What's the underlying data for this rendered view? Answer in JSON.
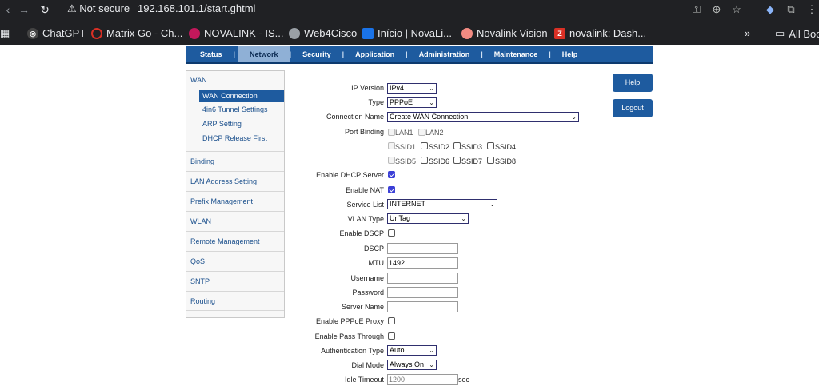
{
  "browser": {
    "secure_label": "Not secure",
    "url": "192.168.101.1/start.ghtml",
    "bookmarks": [
      {
        "label": "ChatGPT",
        "color": "#e8eaed"
      },
      {
        "label": "Matrix Go - Ch...",
        "color": "#d93025"
      },
      {
        "label": "NOVALINK - IS...",
        "color": "#c2185b"
      },
      {
        "label": "Web4Cisco",
        "color": "#9aa0a6"
      },
      {
        "label": "Início | NovaLi...",
        "color": "#1a73e8"
      },
      {
        "label": "Novalink Vision",
        "color": "#f28b82"
      },
      {
        "label": "novalink: Dash...",
        "color": "#d93025"
      }
    ],
    "more": "»",
    "all_bookmarks": "All Boo"
  },
  "topnav": [
    "Status",
    "Network",
    "Security",
    "Application",
    "Administration",
    "Maintenance",
    "Help"
  ],
  "topnav_sep": "|",
  "sidebar": {
    "wan": "WAN",
    "sub": [
      "WAN Connection",
      "4in6 Tunnel Settings",
      "ARP Setting",
      "DHCP Release First"
    ],
    "items": [
      "Binding",
      "LAN Address Setting",
      "Prefix Management",
      "WLAN",
      "Remote Management",
      "QoS",
      "SNTP",
      "Routing"
    ]
  },
  "buttons": {
    "help": "Help",
    "logout": "Logout"
  },
  "form": {
    "ip_version": {
      "label": "IP Version",
      "value": "IPv4"
    },
    "type": {
      "label": "Type",
      "value": "PPPoE"
    },
    "connection_name": {
      "label": "Connection Name",
      "value": "Create WAN Connection"
    },
    "port_binding": {
      "label": "Port Binding",
      "ports": [
        "LAN1",
        "LAN2",
        "SSID1",
        "SSID2",
        "SSID3",
        "SSID4",
        "SSID5",
        "SSID6",
        "SSID7",
        "SSID8"
      ]
    },
    "enable_dhcp_server": {
      "label": "Enable DHCP Server",
      "checked": true
    },
    "enable_nat": {
      "label": "Enable NAT",
      "checked": true
    },
    "service_list": {
      "label": "Service List",
      "value": "INTERNET"
    },
    "vlan_type": {
      "label": "VLAN Type",
      "value": "UnTag"
    },
    "enable_dscp": {
      "label": "Enable DSCP",
      "checked": false
    },
    "dscp": {
      "label": "DSCP",
      "value": ""
    },
    "mtu": {
      "label": "MTU",
      "value": "1492"
    },
    "username": {
      "label": "Username",
      "value": ""
    },
    "password": {
      "label": "Password",
      "value": ""
    },
    "server_name": {
      "label": "Server Name",
      "value": ""
    },
    "enable_pppoe_proxy": {
      "label": "Enable PPPoE Proxy",
      "checked": false
    },
    "enable_pass_through": {
      "label": "Enable Pass Through",
      "checked": false
    },
    "auth_type": {
      "label": "Authentication Type",
      "value": "Auto"
    },
    "dial_mode": {
      "label": "Dial Mode",
      "value": "Always On"
    },
    "idle_timeout": {
      "label": "Idle Timeout",
      "value": "1200",
      "unit": "sec"
    }
  }
}
